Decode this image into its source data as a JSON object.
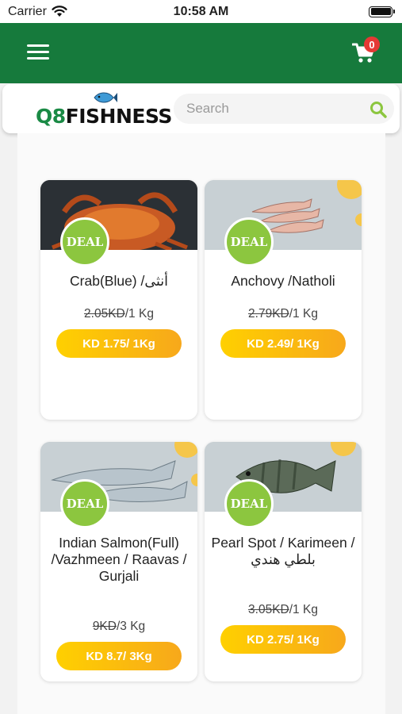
{
  "status_bar": {
    "carrier": "Carrier",
    "time": "10:58 AM"
  },
  "app_bar": {
    "cart_count": "0"
  },
  "header": {
    "logo_prefix": "Q8",
    "logo_word": "FISHNESS",
    "search_placeholder": "Search"
  },
  "colors": {
    "brand_green": "#167a3c",
    "deal_green": "#8cc63f",
    "button_yellow": "#ffc20e",
    "badge_red": "#e53935"
  },
  "products": [
    {
      "name": "Crab(Blue) /أنثى",
      "old_price": "2.05KD",
      "unit": "/1 Kg",
      "deal_label": "DEAL",
      "price": "KD 1.75/ 1Kg"
    },
    {
      "name": "Anchovy /Natholi",
      "old_price": "2.79KD",
      "unit": "/1 Kg",
      "deal_label": "DEAL",
      "price": "KD 2.49/ 1Kg"
    },
    {
      "name": "Indian Salmon(Full) /Vazhmeen / Raavas / Gurjali",
      "old_price": "9KD",
      "unit": "/3 Kg",
      "deal_label": "DEAL",
      "price": "KD 8.7/ 3Kg"
    },
    {
      "name": "Pearl Spot / Karimeen / بلطي هندي",
      "old_price": "3.05KD",
      "unit": "/1 Kg",
      "deal_label": "DEAL",
      "price": "KD 2.75/ 1Kg"
    }
  ]
}
